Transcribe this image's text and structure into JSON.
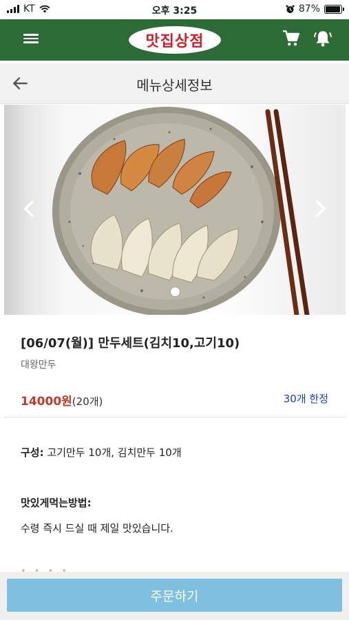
{
  "status_bar": {
    "carrier": "KT",
    "time": "오후 3:25",
    "battery": "87%",
    "battery_level": 0.87
  },
  "app_bar": {
    "logo_text": "맛집상점",
    "menu_icon": "hamburger-icon",
    "cart_icon": "cart-icon",
    "bell_icon": "bell-icon"
  },
  "page": {
    "title": "메뉴상세정보",
    "back_icon": "back-arrow-icon"
  },
  "carousel": {
    "prev_icon": "chevron-left-icon",
    "next_icon": "chevron-right-icon",
    "image": "dumplings-plate-photo"
  },
  "product": {
    "name": "[06/07(월)] 만두세트(김치10,고기10)",
    "vendor": "대왕만두",
    "price": "14000원",
    "quantity": "(20개)",
    "limit": "30개 한정"
  },
  "details": {
    "composition_label": "구성:",
    "composition_value": "고기만두 10개, 김치만두 10개",
    "howto_label": "맛있게먹는방법:",
    "howto_value": "수령 즉시 드실 때 제일 맛있습니다."
  },
  "order_button": {
    "label": "주문하기"
  },
  "colors": {
    "app_bar": "#2c6b36",
    "logo_text": "#d11f24",
    "price": "#c0392b",
    "limit": "#1a3bd1",
    "order_button": "#7fbfe0"
  }
}
